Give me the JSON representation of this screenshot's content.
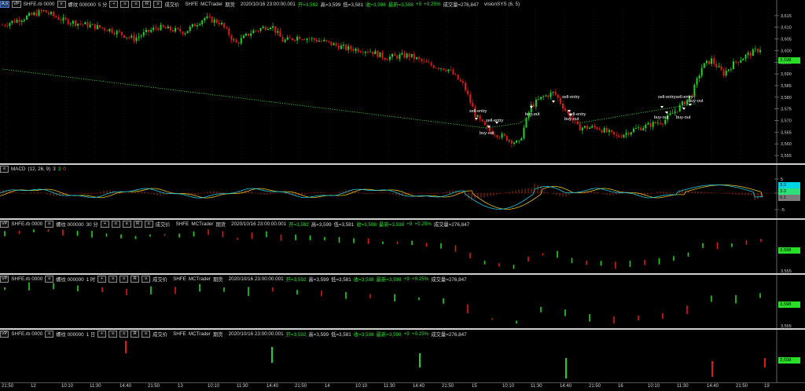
{
  "panes": [
    {
      "id": "main",
      "top": 0,
      "height": 208,
      "header": {
        "buttons": [
          "A,6",
          "VP"
        ],
        "symbol": "SHFE.rb 0000",
        "contract_glyph": "≡",
        "name": "螺纹 000000",
        "interval": "5 分",
        "icons": [
          "+",
          "≡",
          "≡",
          "R",
          "≡"
        ],
        "chg_label": "成交价",
        "source": "SHFE",
        "broker": "MCTrader",
        "futures": "期货",
        "datetime": "2020/10/16 23:00:00.001",
        "open": "开=3,592",
        "high": "高=3,599",
        "low": "低=3,581",
        "close": "收=3,598",
        "last": "最新=3,598",
        "change": "+9",
        "pct": "+0.25%",
        "volume": "成交量=276,847",
        "study": "visionSYS (6, 5)"
      },
      "y_ticks": [
        "3,615",
        "3,610",
        "3,605",
        "3,600",
        "3,595",
        "3,590",
        "3,585",
        "3,580",
        "3,575",
        "3,570",
        "3,565",
        "3,560",
        "3,555"
      ],
      "y_range": [
        3553,
        3619
      ],
      "price_tag": "3,598",
      "price_tag_color": "#27e027"
    },
    {
      "id": "macd",
      "top": 210,
      "height": 68,
      "label": "MACD",
      "params": "(12, 26, 9)",
      "values": [
        "3",
        "3",
        "0"
      ],
      "y_ticks": [
        "5",
        "0",
        "-5"
      ],
      "tags": [
        {
          "text": "3.0",
          "color": "#00d5e8"
        },
        {
          "text": "3.0",
          "color": "#2ee07a"
        },
        {
          "text": "0.1",
          "color": "#a0a0a0"
        }
      ]
    },
    {
      "id": "p30",
      "top": 280,
      "height": 68,
      "header": {
        "buttons": [
          "VP"
        ],
        "symbol": "SHFE.rb 0000",
        "contract_glyph": "≡",
        "name": "螺纹 000000",
        "interval": "30 分",
        "icons": [
          "+",
          "≡",
          "≡",
          "R",
          "≡"
        ],
        "chg_label": "成交价",
        "source": "SHFE",
        "broker": "MCTrader",
        "futures": "期货",
        "datetime": "2020/10/16 23:00:00.001",
        "open": "开=3,592",
        "high": "高=3,599",
        "low": "低=3,581",
        "close": "收=3,598",
        "last": "最新=3,598",
        "change": "+9",
        "pct": "+0.25%",
        "volume": "成交量=276,847",
        "study": ""
      },
      "price_tag": "3,598",
      "bottom_tick": "3,555"
    },
    {
      "id": "p1h",
      "top": 350,
      "height": 68,
      "header": {
        "buttons": [
          "VP"
        ],
        "symbol": "SHFE.rb 0000",
        "contract_glyph": "≡",
        "name": "螺纹 000000",
        "interval": "1 时",
        "icons": [
          "+",
          "≡",
          "≡",
          "R",
          "≡"
        ],
        "chg_label": "成交价",
        "source": "SHFE",
        "broker": "MCTrader",
        "futures": "期货",
        "datetime": "2020/10/16 23:00:00.001",
        "open": "开=3,592",
        "high": "高=3,599",
        "low": "低=3,581",
        "close": "收=3,598",
        "last": "最新=3,598",
        "change": "+9",
        "pct": "+0.25%",
        "volume": "成交量=276,847",
        "study": ""
      },
      "price_tag": "3,598",
      "bottom_tick": "3,555"
    },
    {
      "id": "p1d",
      "top": 420,
      "height": 67,
      "header": {
        "buttons": [
          "VP"
        ],
        "symbol": "SHFE.rb 0000",
        "contract_glyph": "≡",
        "name": "螺纹 000000",
        "interval": "1 日",
        "icons": [
          "+",
          "≡",
          "≡",
          "R",
          "≡"
        ],
        "chg_label": "成交价",
        "source": "SHFE",
        "broker": "MCTrader",
        "futures": "期货",
        "datetime": "2020/10/16 23:00:00.001",
        "open": "开=3,592",
        "high": "高=3,599",
        "low": "低=3,581",
        "close": "收=3,598",
        "last": "最新=3,598",
        "change": "+9",
        "pct": "+0.25%",
        "volume": "成交量=276,847",
        "study": ""
      },
      "price_tag": "3,598"
    }
  ],
  "signals": [
    {
      "text": "sell-entry",
      "x": 597,
      "y": 139
    },
    {
      "text": "sell-entry",
      "x": 618,
      "y": 151
    },
    {
      "text": "buy-out",
      "x": 610,
      "y": 167
    },
    {
      "text": "buy-out",
      "x": 668,
      "y": 143
    },
    {
      "text": "sell-entry",
      "x": 715,
      "y": 121
    },
    {
      "text": "sell-entry",
      "x": 723,
      "y": 143
    },
    {
      "text": "buy-out",
      "x": 718,
      "y": 149
    },
    {
      "text": "sell-entrysell-entry",
      "x": 837,
      "y": 121
    },
    {
      "text": "buy-out",
      "x": 876,
      "y": 126
    },
    {
      "text": "buy-out",
      "x": 832,
      "y": 147
    },
    {
      "text": "buy-out",
      "x": 860,
      "y": 147
    }
  ],
  "x_axis": [
    {
      "label": "21:50",
      "x": 8
    },
    {
      "label": "12",
      "x": 45
    },
    {
      "label": "10:10",
      "x": 84
    },
    {
      "label": "11:30",
      "x": 120
    },
    {
      "label": "14:40",
      "x": 158
    },
    {
      "label": "21:50",
      "x": 194
    },
    {
      "label": "13",
      "x": 232
    },
    {
      "label": "10:10",
      "x": 270
    },
    {
      "label": "11:30",
      "x": 307
    },
    {
      "label": "14:40",
      "x": 345
    },
    {
      "label": "21:50",
      "x": 381
    },
    {
      "label": "14",
      "x": 419
    },
    {
      "label": "10:10",
      "x": 458
    },
    {
      "label": "11:30",
      "x": 494
    },
    {
      "label": "14:40",
      "x": 531
    },
    {
      "label": "21:50",
      "x": 568
    },
    {
      "label": "15",
      "x": 606
    },
    {
      "label": "10:10",
      "x": 645
    },
    {
      "label": "11:30",
      "x": 681
    },
    {
      "label": "14:40",
      "x": 718
    },
    {
      "label": "21:50",
      "x": 755
    },
    {
      "label": "16",
      "x": 792
    },
    {
      "label": "10:10",
      "x": 830
    },
    {
      "label": "11:30",
      "x": 867
    },
    {
      "label": "14:40",
      "x": 905
    },
    {
      "label": "21:50",
      "x": 942
    },
    {
      "label": "19",
      "x": 978
    }
  ],
  "colors": {
    "up": "#1fd41f",
    "down": "#e01818",
    "signal_line": "#39c639",
    "macd": "#18c8e6",
    "signal": "#e8c21a",
    "hist": "#c23a16"
  }
}
